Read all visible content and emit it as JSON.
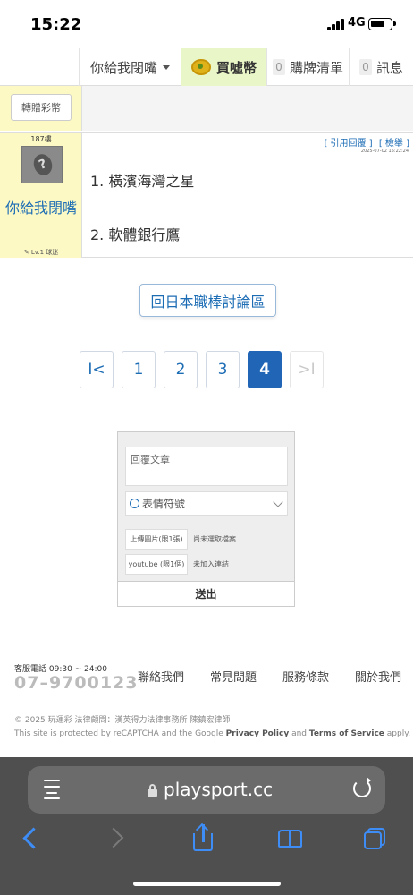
{
  "status_bar": {
    "time": "15:22",
    "network": "4G"
  },
  "nav": {
    "user_label": "你給我閉嘴",
    "coin_label": "買噓幣",
    "list_count": "0",
    "list_label": "購牌清單",
    "msg_count": "0",
    "msg_label": "訊息"
  },
  "gift_button": "轉贈彩幣",
  "post": {
    "floor": "187樓",
    "author": "你給我閉嘴",
    "level": "✎ Lv.1 球迷",
    "quote_label": "[ 引用回覆 ]",
    "report_label": "[ 檢舉 ]",
    "date": "2025-07-02 15:22:24",
    "lines": [
      "1. 橫濱海灣之星",
      "2. 軟體銀行鷹"
    ]
  },
  "back_button": "回日本職棒討論區",
  "pagination": {
    "first": "I<",
    "pages": [
      "1",
      "2",
      "3",
      "4"
    ],
    "current": "4",
    "last": ">I"
  },
  "reply_form": {
    "placeholder": "回覆文章",
    "emoji_label": "表情符號",
    "upload_image": "上傳圖片(限1張)",
    "upload_image_status": "尚未選取檔案",
    "youtube_label": "youtube (限1個)",
    "youtube_status": "未加入連結",
    "submit": "送出"
  },
  "footer": {
    "service_hours": "客服電話 09:30 ~ 24:00",
    "phone": "07–9700123",
    "links": [
      "聯絡我們",
      "常見問題",
      "服務條款",
      "關於我們"
    ],
    "copyright": "© 2025 玩運彩 法律顧問：漢英得力法律事務所 陳鎮宏律師",
    "recaptcha_prefix": "This site is protected by reCAPTCHA and the Google ",
    "privacy": "Privacy Policy",
    "and": " and ",
    "terms": "Terms of Service",
    "recaptcha_suffix": " apply."
  },
  "browser": {
    "url": "playsport.cc"
  }
}
